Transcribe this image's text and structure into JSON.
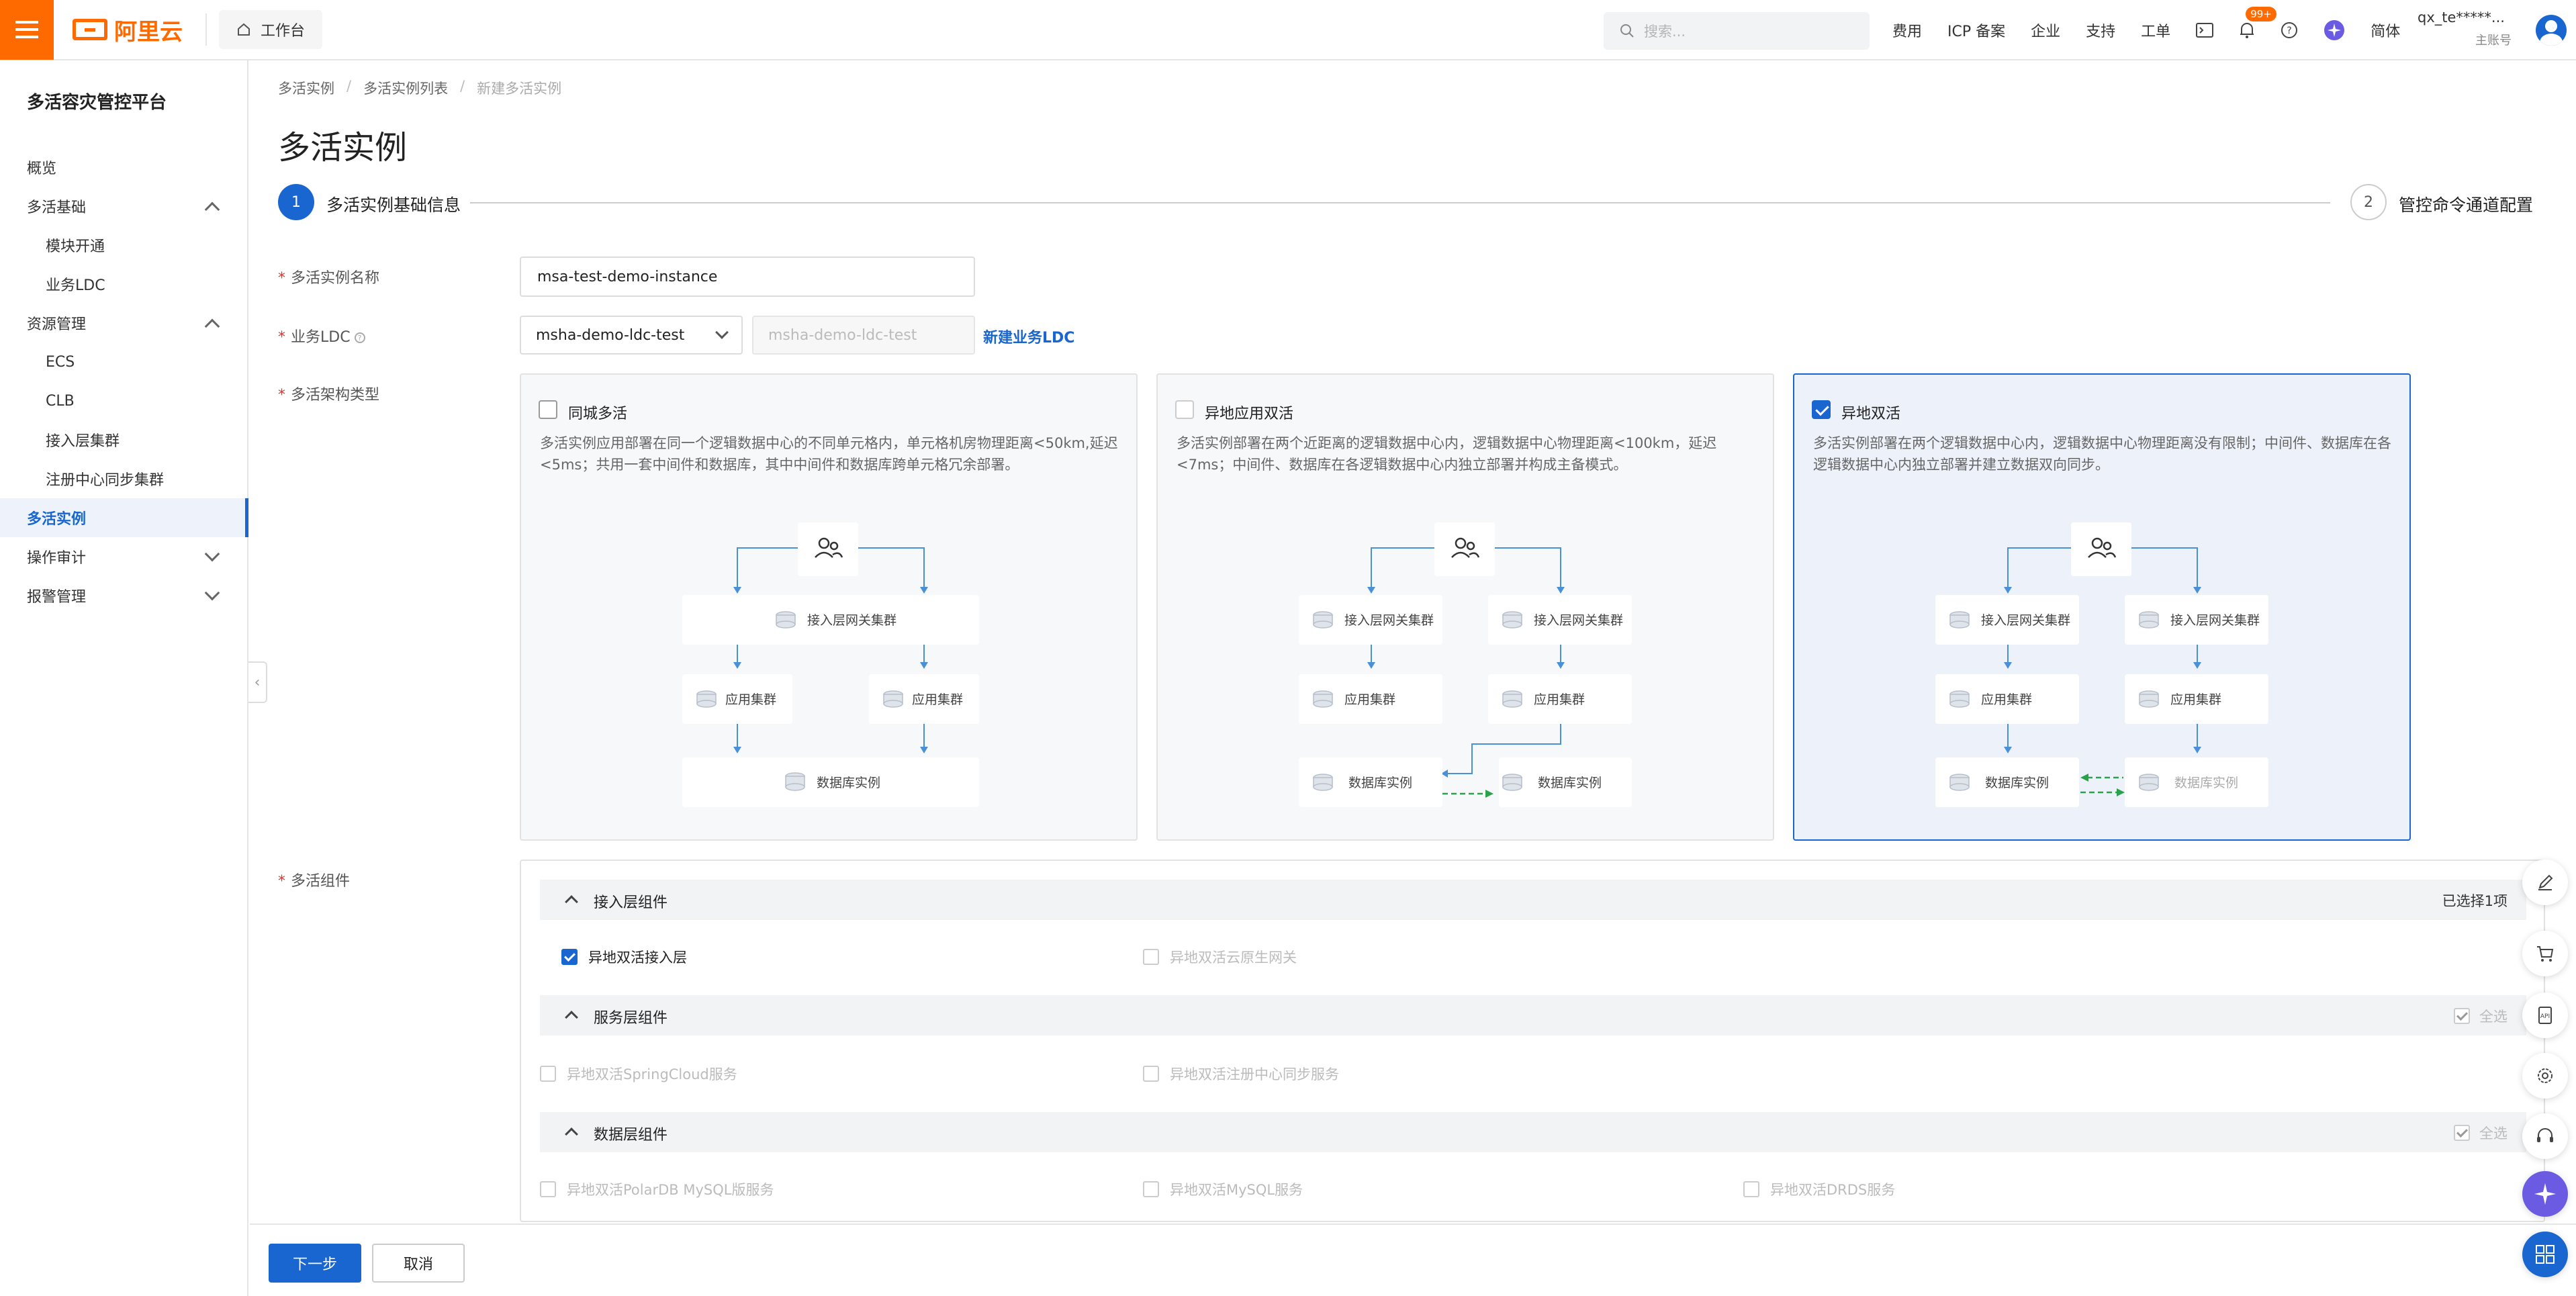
{
  "topbar": {
    "brand": "阿里云",
    "workbench": "工作台",
    "search_placeholder": "搜索...",
    "links": [
      "费用",
      "ICP 备案",
      "企业",
      "支持",
      "工单"
    ],
    "notification_badge": "99+",
    "language": "简体",
    "account_name": "qx_te*****...",
    "account_role": "主账号"
  },
  "sidebar": {
    "title": "多活容灾管控平台",
    "items": [
      {
        "label": "概览"
      },
      {
        "label": "多活基础"
      },
      {
        "label": "模块开通"
      },
      {
        "label": "业务LDC"
      },
      {
        "label": "资源管理"
      },
      {
        "label": "ECS"
      },
      {
        "label": "CLB"
      },
      {
        "label": "接入层集群"
      },
      {
        "label": "注册中心同步集群"
      },
      {
        "label": "多活实例"
      },
      {
        "label": "操作审计"
      },
      {
        "label": "报警管理"
      }
    ]
  },
  "breadcrumb": [
    "多活实例",
    "多活实例列表",
    "新建多活实例"
  ],
  "page_title": "多活实例",
  "steps": [
    {
      "num": "1",
      "label": "多活实例基础信息"
    },
    {
      "num": "2",
      "label": "管控命令通道配置"
    }
  ],
  "form": {
    "name_label": "多活实例名称",
    "name_value": "msa-test-demo-instance",
    "ldc_label": "业务LDC",
    "ldc_value": "msha-demo-ldc-test",
    "ldc_value2": "msha-demo-ldc-test",
    "new_ldc_link": "新建业务LDC",
    "arch_label": "多活架构类型",
    "comp_label": "多活组件"
  },
  "arch_cards": [
    {
      "title": "同城多活",
      "checked": false,
      "desc": "多活实例应用部署在同一个逻辑数据中心的不同单元格内，单元格机房物理距离<50km,延迟<5ms；共用一套中间件和数据库，其中中间件和数据库跨单元格冗余部署。"
    },
    {
      "title": "异地应用双活",
      "checked": false,
      "desc": "多活实例部署在两个近距离的逻辑数据中心内，逻辑数据中心物理距离<100km，延迟<7ms；中间件、数据库在各逻辑数据中心内独立部署并构成主备模式。"
    },
    {
      "title": "异地双活",
      "checked": true,
      "desc": "多活实例部署在两个逻辑数据中心内，逻辑数据中心物理距离没有限制；中间件、数据库在各逻辑数据中心内独立部署并建立数据双向同步。"
    }
  ],
  "diagram": {
    "gateway": "接入层网关集群",
    "app": "应用集群",
    "db": "数据库实例"
  },
  "components": {
    "groups": [
      {
        "title": "接入层组件",
        "right": "已选择1项",
        "items": [
          "异地双活接入层",
          "异地双活云原生网关"
        ]
      },
      {
        "title": "服务层组件",
        "right": "全选",
        "items": [
          "异地双活SpringCloud服务",
          "异地双活注册中心同步服务"
        ]
      },
      {
        "title": "数据层组件",
        "right": "全选",
        "items": [
          "异地双活PolarDB MySQL版服务",
          "异地双活MySQL服务",
          "异地双活DRDS服务"
        ]
      }
    ]
  },
  "actions": {
    "next": "下一步",
    "cancel": "取消"
  },
  "colors": {
    "brand": "#ff6a00",
    "primary": "#1a66d1"
  }
}
